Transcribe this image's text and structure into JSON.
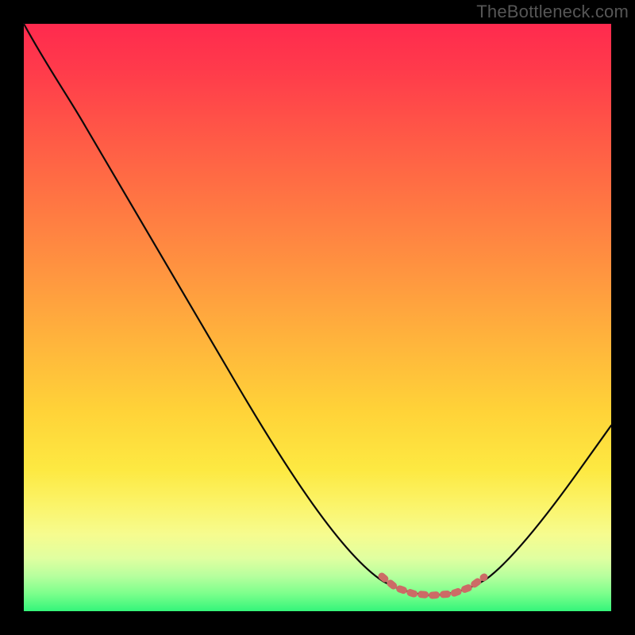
{
  "watermark": "TheBottleneck.com",
  "chart_data": {
    "type": "line",
    "title": "",
    "xlabel": "",
    "ylabel": "",
    "xlim": [
      0,
      100
    ],
    "ylim": [
      0,
      100
    ],
    "grid": false,
    "legend": false,
    "background": "vertical-gradient red→yellow→green (high=bad, low=good)",
    "notes": "V-shaped bottleneck curve; minimum marked by dashed salmon segment near x≈65–80. No axis ticks or numeric labels are rendered.",
    "series": [
      {
        "name": "bottleneck-curve",
        "x": [
          0,
          5,
          10,
          15,
          20,
          25,
          30,
          35,
          40,
          45,
          50,
          55,
          60,
          65,
          70,
          75,
          80,
          85,
          90,
          95,
          100
        ],
        "y": [
          100,
          94,
          87,
          80,
          72,
          64,
          55,
          46,
          37,
          28,
          19,
          12,
          6,
          3,
          2,
          3,
          6,
          12,
          19,
          26,
          32
        ]
      }
    ],
    "annotations": [
      {
        "name": "valley-window",
        "style": "dashed salmon thick",
        "x_range": [
          61,
          79
        ],
        "y_approx": 3
      }
    ]
  }
}
